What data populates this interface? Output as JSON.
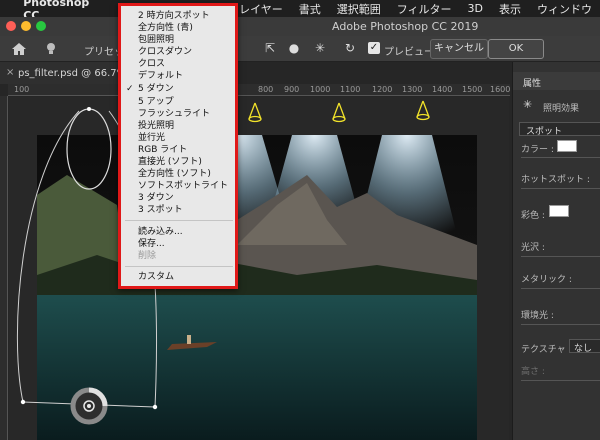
{
  "menubar": {
    "app": "Photoshop CC",
    "items": [
      "ージ",
      "レイヤー",
      "書式",
      "選択範囲",
      "フィルター",
      "3D",
      "表示",
      "ウィンドウ"
    ]
  },
  "window": {
    "title": "Adobe Photoshop CC 2019"
  },
  "options_bar": {
    "preset_label": "プリセッ",
    "preview_label": "プレビュー",
    "preview_checked": true,
    "cancel_label": "キャンセル",
    "ok_label": "OK"
  },
  "document": {
    "tab": "ps_filter.psd @ 66.7%"
  },
  "ruler": {
    "ticks": [
      "100",
      "800",
      "900",
      "1000",
      "1100",
      "1200",
      "1300",
      "1400",
      "1500",
      "1600"
    ]
  },
  "preset_menu": {
    "items": [
      "2 時方向スポット",
      "全方向性 (青)",
      "包囲照明",
      "クロスダウン",
      "クロス",
      "デフォルト",
      "5 ダウン",
      "5 アップ",
      "フラッシュライト",
      "投光照明",
      "並行光",
      "RGB ライト",
      "直接光 (ソフト)",
      "全方向性 (ソフト)",
      "ソフトスポットライト",
      "3 ダウン",
      "3 スポット"
    ],
    "checked_item": "5 ダウン",
    "actions": [
      "読み込み...",
      "保存...",
      "削除"
    ],
    "disabled_action": "削除",
    "custom": "カスタム"
  },
  "properties_panel": {
    "title": "属性",
    "light_effect": "照明効果",
    "light_type": "スポット",
    "color_label": "カラー :",
    "hotspot_label": "ホットスポット :",
    "colorize_label": "彩色 :",
    "gloss_label": "光沢 :",
    "metallic_label": "メタリック :",
    "ambience_label": "環境光 :",
    "texture_label": "テクスチャ :",
    "texture_value": "なし",
    "height_label": "高さ :"
  },
  "colors": {
    "accent_red": "#e01818",
    "light_widget_yellow": "#f2e32a",
    "menu_bg": "#e8e8e8"
  }
}
